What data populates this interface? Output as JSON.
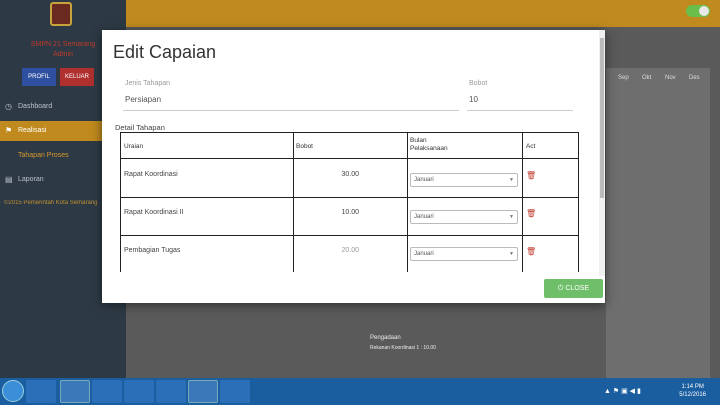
{
  "sidebar": {
    "user_name": "SMPN 21 Semarang",
    "user_sub": "Admin",
    "profile_btn": "PROFIL",
    "logout_btn": "KELUAR",
    "items": [
      {
        "label": "Dashboard",
        "icon": "clock-icon"
      },
      {
        "label": "Realisasi",
        "icon": "flag-icon"
      },
      {
        "label": "Tahapan Proses",
        "icon": ""
      },
      {
        "label": "Laporan",
        "icon": "file-icon"
      }
    ],
    "footer": "©2015 Pemerintah Kota Semarang"
  },
  "background_table": {
    "months": [
      "Sep",
      "Okt",
      "Nov",
      "Des"
    ],
    "note_title": "Pengadaan",
    "note_detail": "Rekanan Koordinasi 1 : 10.00"
  },
  "modal": {
    "title": "Edit Capaian",
    "field_jenis_label": "Jenis Tahapan",
    "field_jenis_value": "Persiapan",
    "field_bobot_label": "Bobot",
    "field_bobot_value": "10",
    "detail_title": "Detail Tahapan",
    "columns": [
      "Uraian",
      "Bobot",
      "Bulan Pelaksanaan",
      "Act"
    ],
    "rows": [
      {
        "uraian": "Rapat Koordinasi",
        "bobot": "30.00",
        "bulan": "Januari"
      },
      {
        "uraian": "Rapat Koordinasi II",
        "bobot": "10.00",
        "bulan": "Januari"
      },
      {
        "uraian": "Pembagian Tugas",
        "bobot": "20.00",
        "bulan": "Januari"
      }
    ],
    "close_label": "CLOSE"
  },
  "taskbar": {
    "time": "1:14 PM",
    "date": "5/12/2016"
  }
}
